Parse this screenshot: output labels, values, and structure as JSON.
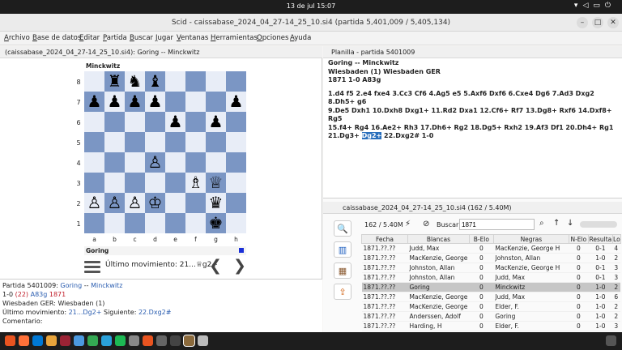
{
  "topbar": {
    "clock": "13 de jul  15:07",
    "tray_icons": [
      "network-icon",
      "volume-icon",
      "battery-icon",
      "power-menu-icon"
    ]
  },
  "window": {
    "title": "Scid - caissabase_2024_04_27-14_25_10.si4 (partida 5,401,009 / 5,405,134)"
  },
  "menu": [
    "Archivo",
    "Base de datos",
    "Editar",
    "Partida",
    "Buscar",
    "Jugar",
    "Ventanas",
    "Herramientas",
    "Opciones",
    "Ayuda"
  ],
  "left": {
    "tab": "(caissabase_2024_04_27-14_25_10.si4): Goring -- Minckwitz",
    "top_player": "Minckwitz",
    "bottom_player": "Goring",
    "last_move": "Último movimiento: 21...♕g2+",
    "ranks": [
      "8",
      "7",
      "6",
      "5",
      "4",
      "3",
      "2",
      "1"
    ],
    "files": [
      "a",
      "b",
      "c",
      "d",
      "e",
      "f",
      "g",
      "h"
    ],
    "board": [
      [
        "",
        "♜",
        "♞",
        "♝",
        "",
        "",
        "",
        ""
      ],
      [
        "♟",
        "♟",
        "♟",
        "♟",
        "",
        "",
        "",
        "♟"
      ],
      [
        "",
        "",
        "",
        "",
        "♟",
        "",
        "♟",
        ""
      ],
      [
        "",
        "",
        "",
        "",
        "",
        "",
        "",
        ""
      ],
      [
        "",
        "",
        "",
        "♙",
        "",
        "",
        "",
        ""
      ],
      [
        "",
        "",
        "",
        "",
        "",
        "♗",
        "♕",
        ""
      ],
      [
        "♙",
        "♙",
        "♙",
        "♔",
        "",
        "",
        "♛",
        ""
      ],
      [
        "",
        "",
        "",
        "",
        "",
        "",
        "♚",
        ""
      ]
    ],
    "info": {
      "line1_prefix": "Partida 5401009:",
      "white": "Goring",
      "sep": "--",
      "black": "Minckwitz",
      "result": "1-0",
      "plies": "(22)",
      "eco": "A83g",
      "year": "1871",
      "event": "Wiesbaden GER:  Wiesbaden (1)",
      "last_label": "Último movimiento:",
      "last_move": "21...Dg2+",
      "next_label": "Siguiente:",
      "next_move": "22.Dxg2#",
      "comment_label": "Comentario:"
    }
  },
  "notation": {
    "tab": "Planilla - partida 5401009",
    "header1": "Goring   --   Minckwitz",
    "header2": "Wiesbaden (1)  Wiesbaden GER",
    "header3": "1871   1-0   A83g",
    "line1": "1.d4 f5 2.e4 fxe4 3.Cc3 Cf6 4.Ag5 e5 5.Axf6 Dxf6 6.Cxe4 Dg6 7.Ad3 Dxg2 8.Dh5+ g6",
    "line2": "9.De5 Dxh1 10.Dxh8 Dxg1+ 11.Rd2 Dxa1 12.Cf6+ Rf7 13.Dg8+ Rxf6 14.Dxf8+ Rg5",
    "line3": "15.f4+ Rg4 16.Ae2+ Rh3 17.Dh6+ Rg2 18.Dg5+ Rxh2 19.Af3 Df1 20.Dh4+ Rg1",
    "line4_a": "21.Dg3+",
    "line4_hl": "Dg2+",
    "line4_b": "22.Dxg2# 1-0"
  },
  "database": {
    "tab": "caissabase_2024_04_27-14_25_10.si4 (162 / 5.40M)",
    "count": "162 / 5.40M",
    "search_label": "Buscar",
    "search_value": "1871",
    "columns": [
      "Fecha",
      "Blancas",
      "B-Elo",
      "Negras",
      "N-Elo",
      "Resulta",
      "Lo"
    ],
    "rows": [
      [
        "1871.??.??",
        "Judd, Max",
        "0",
        "MacKenzie, George H",
        "0",
        "0-1",
        "4"
      ],
      [
        "1871.??.??",
        "MacKenzie, George",
        "0",
        "Johnston, Allan",
        "0",
        "1-0",
        "2"
      ],
      [
        "1871.??.??",
        "Johnston, Allan",
        "0",
        "MacKenzie, George H",
        "0",
        "0-1",
        "3"
      ],
      [
        "1871.??.??",
        "Johnston, Allan",
        "0",
        "Judd, Max",
        "0",
        "0-1",
        "3"
      ],
      [
        "1871.??.??",
        "Goring",
        "0",
        "Minckwitz",
        "0",
        "1-0",
        "2"
      ],
      [
        "1871.??.??",
        "MacKenzie, George",
        "0",
        "Judd, Max",
        "0",
        "1-0",
        "6"
      ],
      [
        "1871.??.??",
        "MacKenzie, George",
        "0",
        "Elder, F.",
        "0",
        "1-0",
        "2"
      ],
      [
        "1871.??.??",
        "Anderssen, Adolf",
        "0",
        "Goring",
        "0",
        "1-0",
        "2"
      ],
      [
        "1871.??.??",
        "Harding, H",
        "0",
        "Elder, F.",
        "0",
        "1-0",
        "3"
      ]
    ]
  }
}
